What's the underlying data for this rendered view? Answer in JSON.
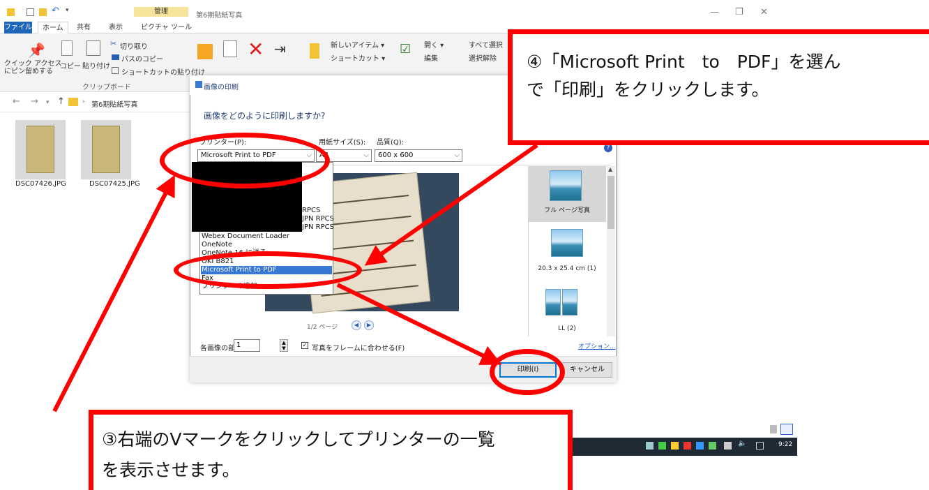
{
  "explorer": {
    "manage_tab": "管理",
    "window_title": "第6期貼紙写真",
    "window_controls": {
      "minimize": "—",
      "restore": "❐",
      "close": "✕"
    },
    "tabs": [
      "ファイル",
      "ホーム",
      "共有",
      "表示",
      "ピクチャ ツール"
    ],
    "ribbon": {
      "pin_label": "クイック アクセス\nにピン留めする",
      "copy": "コピー",
      "paste": "貼り付け",
      "cut": "切り取り",
      "copy_path": "パスのコピー",
      "paste_shortcut": "ショートカットの貼り付け",
      "clipboard_group": "クリップボード",
      "new_item": "新しいアイテム",
      "shortcut": "ショートカット",
      "open": "開く",
      "edit": "編集",
      "select_all": "すべて選択",
      "select_none": "選択解除"
    },
    "breadcrumb": "第6期貼紙写真",
    "files": [
      {
        "name": "DSC07426.JPG"
      },
      {
        "name": "DSC07425.JPG"
      }
    ]
  },
  "print_dialog": {
    "title": "画像の印刷",
    "question": "画像をどのように印刷しますか?",
    "printer_label": "プリンター(P):",
    "printer_value": "Microsoft Print to PDF",
    "paper_label": "用紙サイズ(S):",
    "paper_value": "A4",
    "quality_label": "品質(Q):",
    "quality_value": "600 x 600",
    "help": "?",
    "printer_list": [
      "RPCS",
      "JPN RPCS",
      "JPN RPCS",
      "Webex Document Loader",
      "OneNote",
      "OneNote 16 に送る",
      "OKI B821",
      "Microsoft Print to PDF",
      "Fax",
      "プリンターの追加..."
    ],
    "printer_list_selected_index": 7,
    "page_indicator": "1/2 ページ",
    "layouts": [
      {
        "label": "フル ページ写真",
        "selected": true
      },
      {
        "label": "20.3 x 25.4 cm (1)",
        "selected": false
      },
      {
        "label": "LL (2)",
        "selected": false
      }
    ],
    "copies_label": "各画像の部数(C):",
    "copies_value": "1",
    "fit_label": "写真をフレームに合わせる(F)",
    "fit_checked": true,
    "options_link": "オプション...",
    "print_button": "印刷(I)",
    "cancel_button": "キャンセル"
  },
  "annotations": {
    "step4": [
      "④「Microsoft Print　to　PDF」を選ん",
      "で「印刷」をクリックします。"
    ],
    "step3": [
      "③右端のVマークをクリックしてプリンターの一覧",
      "を表示させます。"
    ],
    "accent_color": "#ff0000"
  },
  "taskbar": {
    "time": "9:22"
  }
}
